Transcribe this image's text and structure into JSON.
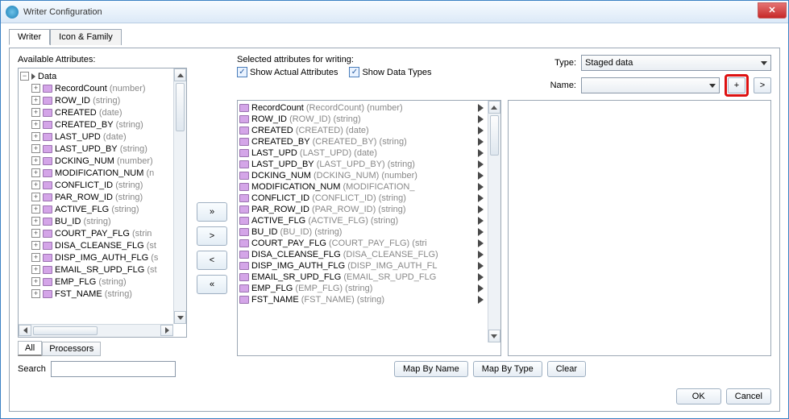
{
  "window": {
    "title": "Writer Configuration"
  },
  "tabs": {
    "t1": "Writer",
    "t2": "Icon & Family"
  },
  "left": {
    "label": "Available Attributes:",
    "root": "Data",
    "items": [
      {
        "name": "RecordCount",
        "type": "(number)"
      },
      {
        "name": "ROW_ID",
        "type": "(string)"
      },
      {
        "name": "CREATED",
        "type": "(date)"
      },
      {
        "name": "CREATED_BY",
        "type": "(string)"
      },
      {
        "name": "LAST_UPD",
        "type": "(date)"
      },
      {
        "name": "LAST_UPD_BY",
        "type": "(string)"
      },
      {
        "name": "DCKING_NUM",
        "type": "(number)"
      },
      {
        "name": "MODIFICATION_NUM",
        "type": "(n"
      },
      {
        "name": "CONFLICT_ID",
        "type": "(string)"
      },
      {
        "name": "PAR_ROW_ID",
        "type": "(string)"
      },
      {
        "name": "ACTIVE_FLG",
        "type": "(string)"
      },
      {
        "name": "BU_ID",
        "type": "(string)"
      },
      {
        "name": "COURT_PAY_FLG",
        "type": "(strin"
      },
      {
        "name": "DISA_CLEANSE_FLG",
        "type": "(st"
      },
      {
        "name": "DISP_IMG_AUTH_FLG",
        "type": "(s"
      },
      {
        "name": "EMAIL_SR_UPD_FLG",
        "type": "(st"
      },
      {
        "name": "EMP_FLG",
        "type": "(string)"
      },
      {
        "name": "FST_NAME",
        "type": "(string)"
      }
    ],
    "filter_all": "All",
    "filter_proc": "Processors",
    "search_label": "Search"
  },
  "move": {
    "addall": "»",
    "add": ">",
    "rem": "<",
    "remall": "«"
  },
  "center": {
    "label": "Selected attributes for writing:",
    "chk1": "Show Actual Attributes",
    "chk2": "Show Data Types",
    "items": [
      {
        "name": "RecordCount",
        "sub": "(RecordCount) (number)"
      },
      {
        "name": "ROW_ID",
        "sub": "(ROW_ID) (string)"
      },
      {
        "name": "CREATED",
        "sub": "(CREATED) (date)"
      },
      {
        "name": "CREATED_BY",
        "sub": "(CREATED_BY) (string)"
      },
      {
        "name": "LAST_UPD",
        "sub": "(LAST_UPD) (date)"
      },
      {
        "name": "LAST_UPD_BY",
        "sub": "(LAST_UPD_BY) (string)"
      },
      {
        "name": "DCKING_NUM",
        "sub": "(DCKING_NUM) (number)"
      },
      {
        "name": "MODIFICATION_NUM",
        "sub": "(MODIFICATION_"
      },
      {
        "name": "CONFLICT_ID",
        "sub": "(CONFLICT_ID) (string)"
      },
      {
        "name": "PAR_ROW_ID",
        "sub": "(PAR_ROW_ID) (string)"
      },
      {
        "name": "ACTIVE_FLG",
        "sub": "(ACTIVE_FLG) (string)"
      },
      {
        "name": "BU_ID",
        "sub": "(BU_ID) (string)"
      },
      {
        "name": "COURT_PAY_FLG",
        "sub": "(COURT_PAY_FLG) (stri"
      },
      {
        "name": "DISA_CLEANSE_FLG",
        "sub": "(DISA_CLEANSE_FLG)"
      },
      {
        "name": "DISP_IMG_AUTH_FLG",
        "sub": "(DISP_IMG_AUTH_FL"
      },
      {
        "name": "EMAIL_SR_UPD_FLG",
        "sub": "(EMAIL_SR_UPD_FLG"
      },
      {
        "name": "EMP_FLG",
        "sub": "(EMP_FLG) (string)"
      },
      {
        "name": "FST_NAME",
        "sub": "(FST_NAME) (string)"
      }
    ],
    "map_name": "Map By Name",
    "map_type": "Map By Type",
    "clear": "Clear"
  },
  "right": {
    "type_label": "Type:",
    "type_value": "Staged data",
    "name_label": "Name:",
    "name_value": "",
    "plus": "+",
    "next": ">"
  },
  "footer": {
    "ok": "OK",
    "cancel": "Cancel"
  }
}
